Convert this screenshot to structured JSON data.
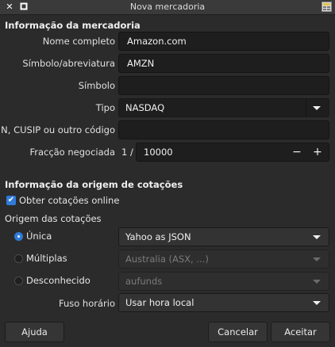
{
  "window": {
    "title": "Nova mercadoria"
  },
  "sections": {
    "commodity_info": "Informação da mercadoria",
    "quote_source_info": "Informação da origem de cotações"
  },
  "fields": {
    "full_name": {
      "label": "Nome completo",
      "value": "Amazon.com"
    },
    "symbol_abbrev": {
      "label": "Símbolo/abreviatura",
      "value": "AMZN"
    },
    "symbol": {
      "label": "Símbolo",
      "value": ""
    },
    "type": {
      "label": "Tipo",
      "value": "NASDAQ"
    },
    "isin": {
      "label": "ISIN, CUSIP ou outro código",
      "value": ""
    },
    "fraction": {
      "label": "Fracção negociada",
      "prefix": "1 /",
      "value": "10000",
      "minus": "−",
      "plus": "+"
    }
  },
  "quotes": {
    "online_checkbox": {
      "label": "Obter cotações online",
      "checked": true
    },
    "origin_label": "Origem das cotações",
    "single": {
      "label": "Única",
      "value": "Yahoo as JSON",
      "selected": true
    },
    "multiple": {
      "label": "Múltiplas",
      "value": "Australia (ASX, ...)",
      "selected": false
    },
    "unknown": {
      "label": "Desconhecido",
      "value": "aufunds",
      "selected": false
    },
    "timezone": {
      "label": "Fuso horário",
      "value": "Usar hora local"
    }
  },
  "buttons": {
    "help": "Ajuda",
    "cancel": "Cancelar",
    "accept": "Aceitar"
  },
  "colors": {
    "accent": "#2f7bd9",
    "background": "#2b2b2b",
    "field": "#1e1e1e"
  }
}
